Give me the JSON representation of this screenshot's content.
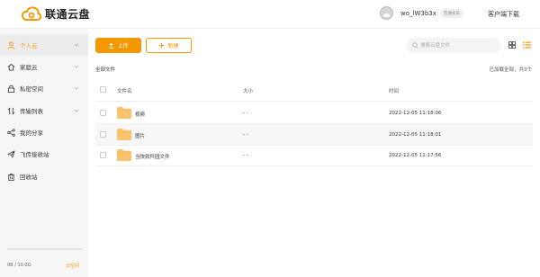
{
  "header": {
    "logo_text": "联通云盘",
    "username": "wo_lW3b3x",
    "member_badge": "普通会员",
    "client_download": "客户端下载"
  },
  "sidebar": {
    "items": [
      {
        "label": "个人云",
        "icon": "person-icon",
        "active": true,
        "chevron": true
      },
      {
        "label": "家庭云",
        "icon": "home-icon",
        "active": false,
        "chevron": true
      },
      {
        "label": "私密空间",
        "icon": "lock-icon",
        "active": false,
        "chevron": true
      },
      {
        "label": "传输列表",
        "icon": "transfer-icon",
        "active": false,
        "chevron": true
      },
      {
        "label": "我的分享",
        "icon": "share-icon",
        "active": false,
        "chevron": false
      },
      {
        "label": "飞传接收站",
        "icon": "send-icon",
        "active": false,
        "chevron": false
      },
      {
        "label": "回收站",
        "icon": "trash-icon",
        "active": false,
        "chevron": false
      }
    ],
    "quota_text": "0B / 10.0G",
    "quota_fraction": 0.0,
    "expand_label": "云空间"
  },
  "toolbar": {
    "upload_label": "上传",
    "new_label": "新建",
    "search_placeholder": "搜索云盘文件"
  },
  "main": {
    "breadcrumb": "全部文件",
    "loaded_text": "已加载全部，共3个",
    "columns": {
      "name": "文件名",
      "size": "大小",
      "time": "时间"
    },
    "rows": [
      {
        "name": "视频",
        "size": "- -",
        "time": "2022-12-05 11:18:06"
      },
      {
        "name": "图片",
        "size": "- -",
        "time": "2022-12-05 11:18:01"
      },
      {
        "name": "当快软件园文件",
        "size": "- -",
        "time": "2022-12-05 11:17:56"
      }
    ]
  },
  "colors": {
    "accent": "#f39800",
    "sidebar_bg": "#f6f6f6",
    "folder": "#f9c46b"
  }
}
